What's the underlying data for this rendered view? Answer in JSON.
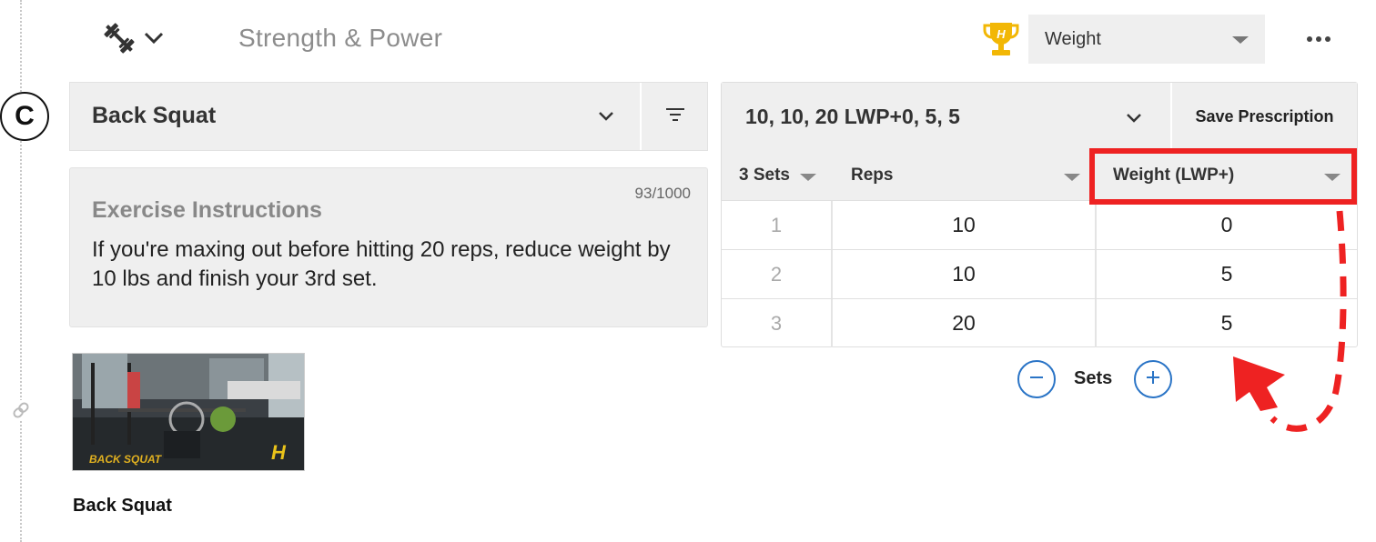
{
  "header": {
    "block_title": "Strength & Power",
    "metric_selected": "Weight",
    "block_type_icon": "barbell-icon",
    "trophy_icon": "trophy-icon",
    "more_icon": "more-horizontal-icon"
  },
  "block_label": "C",
  "exercise": {
    "name": "Back Squat",
    "chevron_icon": "chevron-down-icon",
    "filter_icon": "filter-icon"
  },
  "instructions": {
    "char_count": "93/1000",
    "heading": "Exercise Instructions",
    "text": "If you're maxing out before hitting 20 reps, reduce weight by 10 lbs and finish your 3rd set."
  },
  "thumbnail": {
    "caption": "Back Squat",
    "overlay_text": "BACK SQUAT",
    "logo_text": "H"
  },
  "prescription": {
    "name": "10, 10, 20 LWP+0, 5, 5",
    "save_label": "Save Prescription",
    "columns": {
      "sets": "3 Sets",
      "reps": "Reps",
      "weight": "Weight (LWP+)"
    },
    "rows": [
      {
        "num": "1",
        "reps": "10",
        "weight": "0"
      },
      {
        "num": "2",
        "reps": "10",
        "weight": "5"
      },
      {
        "num": "3",
        "reps": "20",
        "weight": "5"
      }
    ],
    "sets_label": "Sets"
  },
  "colors": {
    "accent_blue": "#2a74c6",
    "annotation_red": "#ee2222",
    "trophy_gold": "#f2b705",
    "panel_gray": "#efefef"
  }
}
